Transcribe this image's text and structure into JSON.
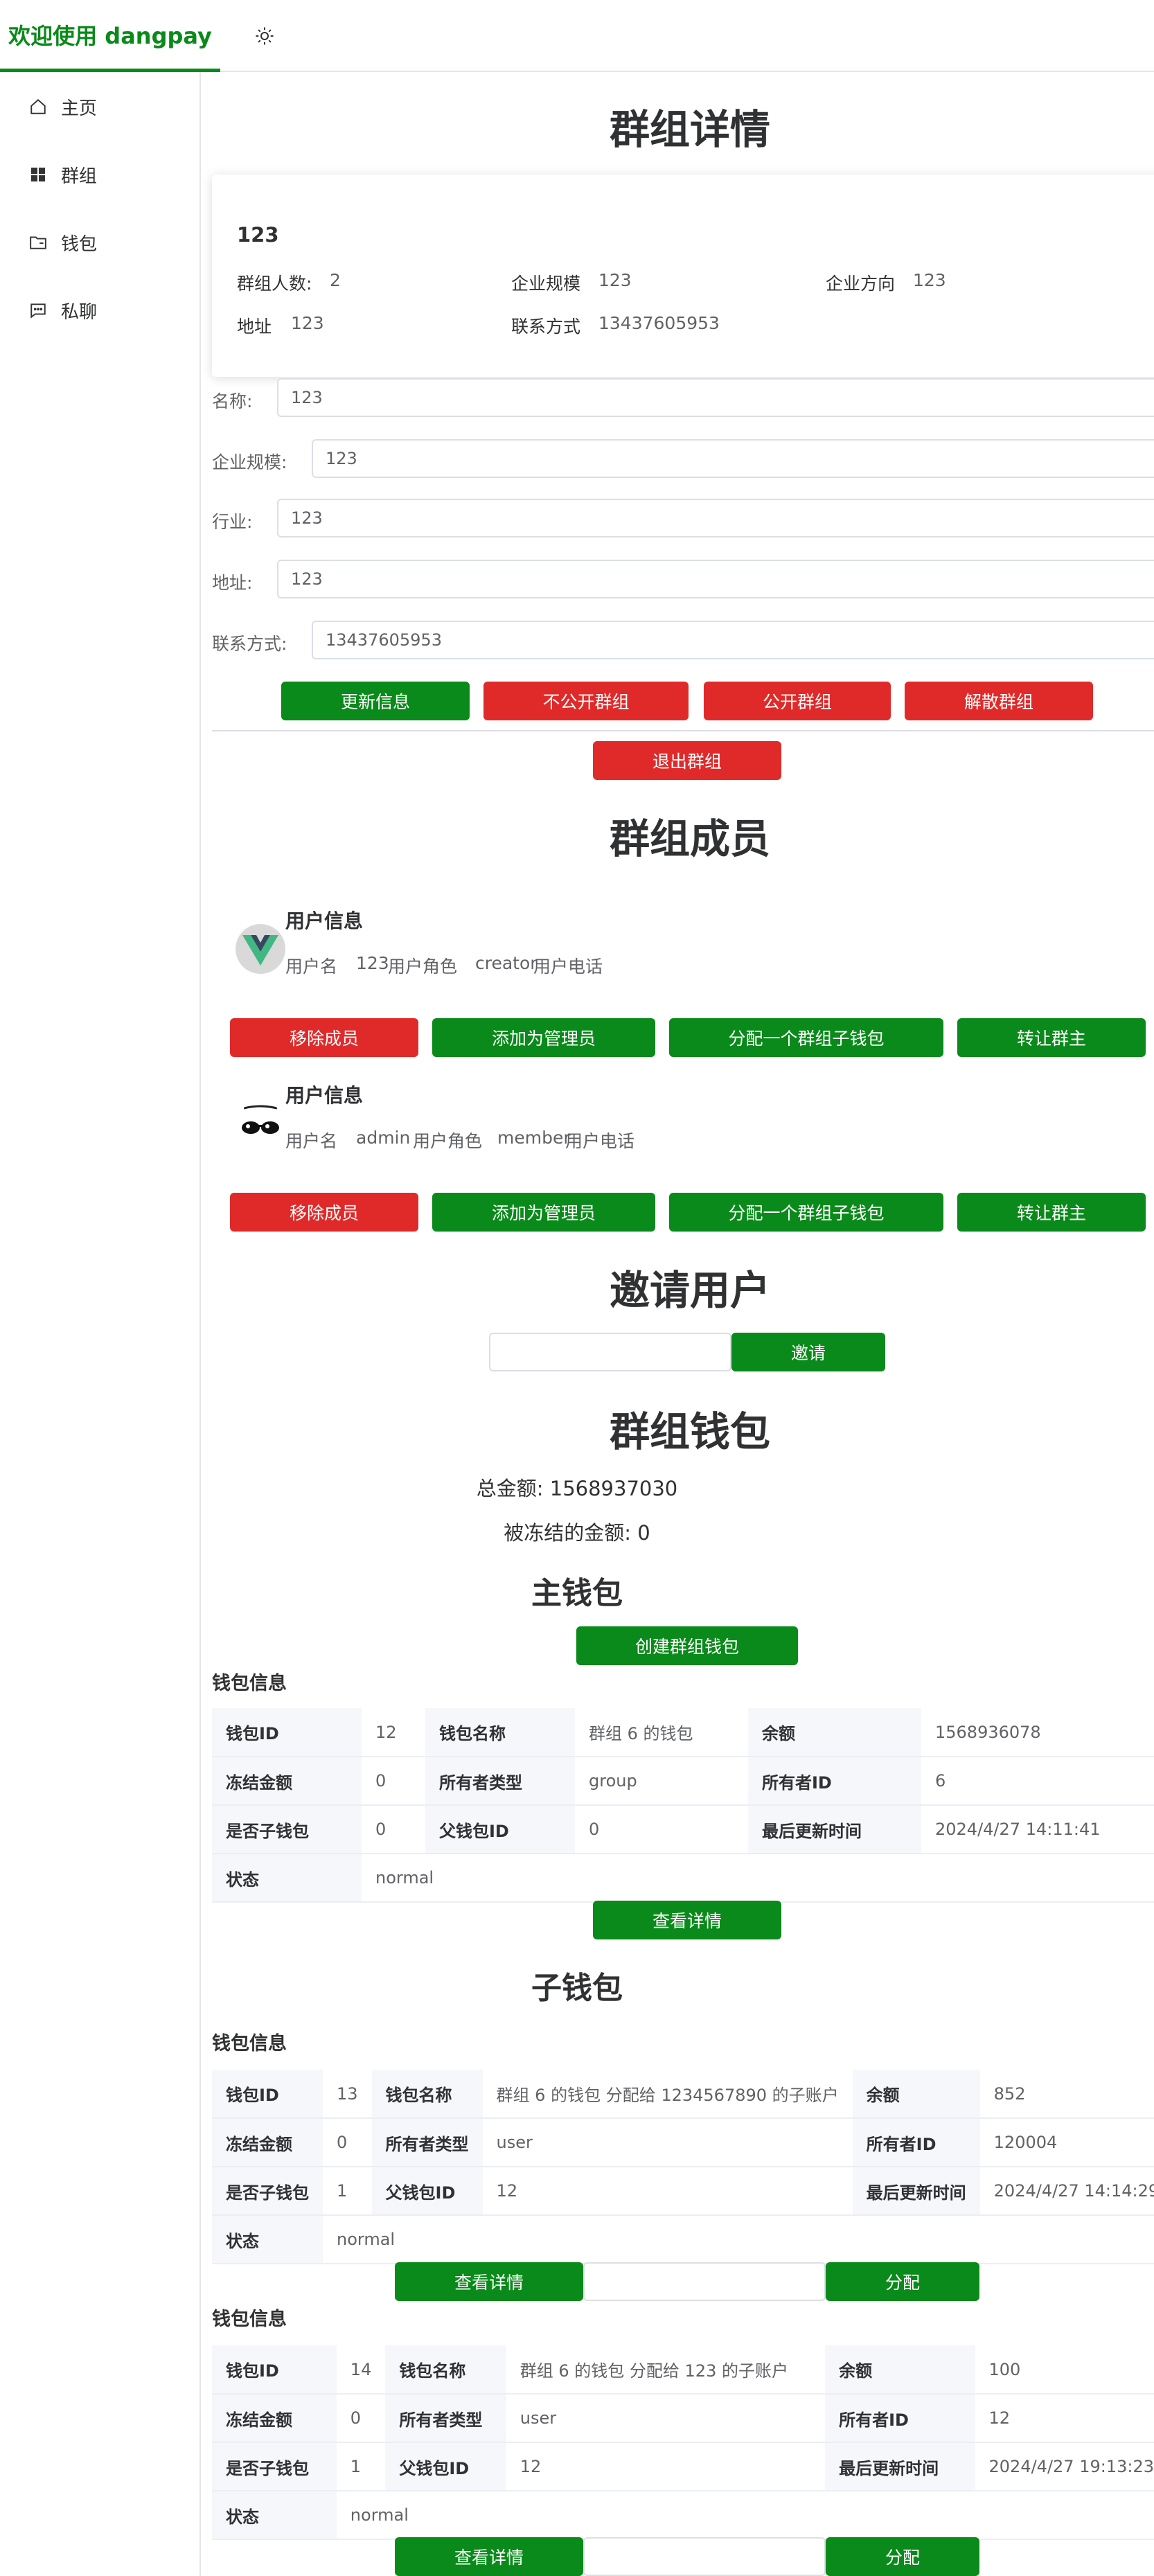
{
  "header": {
    "brand": "欢迎使用 dangpay",
    "theme_icon": "sun-icon"
  },
  "sidebar": {
    "items": [
      {
        "label": "主页",
        "icon": "home-icon"
      },
      {
        "label": "群组",
        "icon": "grid-icon"
      },
      {
        "label": "钱包",
        "icon": "folder-icon"
      },
      {
        "label": "私聊",
        "icon": "chat-icon"
      }
    ]
  },
  "page_title": "群组详情",
  "group_card": {
    "name": "123",
    "members_label": "群组人数:",
    "members": "2",
    "scale_label": "企业规模",
    "scale": "123",
    "direction_label": "企业方向",
    "direction": "123",
    "address_label": "地址",
    "address": "123",
    "contact_label": "联系方式",
    "contact": "13437605953"
  },
  "form": {
    "name_label": "名称:",
    "name_value": "123",
    "scale_label": "企业规模:",
    "scale_value": "123",
    "industry_label": "行业:",
    "industry_value": "123",
    "address_label": "地址:",
    "address_value": "123",
    "contact_label": "联系方式:",
    "contact_value": "13437605953"
  },
  "actions": {
    "update": "更新信息",
    "private": "不公开群组",
    "public": "公开群组",
    "dissolve": "解散群组",
    "quit": "退出群组"
  },
  "members_title": "群组成员",
  "members": [
    {
      "title": "用户信息",
      "username_label": "用户名",
      "username": "123",
      "role_label": "用户角色",
      "role": "creator",
      "phone_label": "用户电话"
    },
    {
      "title": "用户信息",
      "username_label": "用户名",
      "username": "admin",
      "role_label": "用户角色",
      "role": "member",
      "phone_label": "用户电话"
    }
  ],
  "member_actions": {
    "remove": "移除成员",
    "make_admin": "添加为管理员",
    "assign_wallet": "分配一个群组子钱包",
    "transfer": "转让群主"
  },
  "invite": {
    "title": "邀请用户",
    "button": "邀请",
    "placeholder": ""
  },
  "wallet": {
    "title": "群组钱包",
    "total": "总金额: 1568937030",
    "frozen": "被冻结的金额: 0",
    "main_title": "主钱包",
    "create_button": "创建群组钱包",
    "sub_title": "子钱包",
    "info_title": "钱包信息",
    "detail_button": "查看详情",
    "assign_button": "分配"
  },
  "keys": {
    "id": "钱包ID",
    "name": "钱包名称",
    "balance": "余额",
    "frozen": "冻结金额",
    "owner_type": "所有者类型",
    "owner_id": "所有者ID",
    "is_sub": "是否子钱包",
    "parent": "父钱包ID",
    "updated": "最后更新时间",
    "status": "状态"
  },
  "main_wallet": {
    "id": "12",
    "name": "群组 6 的钱包",
    "balance": "1568936078",
    "frozen": "0",
    "owner_type": "group",
    "owner_id": "6",
    "is_sub": "0",
    "parent": "0",
    "updated": "2024/4/27 14:11:41",
    "status": "normal"
  },
  "sub_wallets": [
    {
      "id": "13",
      "name": "群组 6 的钱包 分配给 1234567890 的子账户",
      "balance": "852",
      "frozen": "0",
      "owner_type": "user",
      "owner_id": "120004",
      "is_sub": "1",
      "parent": "12",
      "updated": "2024/4/27 14:14:29",
      "status": "normal"
    },
    {
      "id": "14",
      "name": "群组 6 的钱包 分配给 123 的子账户",
      "balance": "100",
      "frozen": "0",
      "owner_type": "user",
      "owner_id": "12",
      "is_sub": "1",
      "parent": "12",
      "updated": "2024/4/27 19:13:23",
      "status": "normal"
    }
  ],
  "colors": {
    "primary": "#0a8a1a",
    "danger": "#e02a2a"
  }
}
